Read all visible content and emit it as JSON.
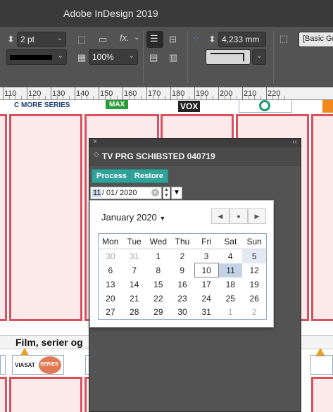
{
  "window": {
    "title": "Adobe InDesign 2019"
  },
  "control_panel": {
    "stroke_weight": "2 pt",
    "opacity": "100%",
    "fx_label": "fx.",
    "dimension": "4,233 mm",
    "style_field": "[Basic Gr"
  },
  "ruler": {
    "labels": [
      "110",
      "120",
      "130",
      "140",
      "150",
      "160",
      "170",
      "180",
      "190",
      "200",
      "210",
      "220"
    ]
  },
  "document": {
    "logos": {
      "cmore": "C MORE SERIES",
      "max": "MAX",
      "vox": "VOX",
      "viasat": "VIASAT",
      "viasat_series": "SERIES"
    },
    "film_text": "Film, serier og"
  },
  "panel": {
    "title": "TV PRG SCHIBSTED 040719",
    "arrows": "◇",
    "process_label": "Process",
    "restore_label": "Restore",
    "date_value": "11/01/2020",
    "date_parts": {
      "mm": "11",
      "dd": "01",
      "yyyy": "2020"
    }
  },
  "calendar": {
    "month_label": "January 2020",
    "weekdays": [
      "Mon",
      "Tue",
      "Wed",
      "Thu",
      "Fri",
      "Sat",
      "Sun"
    ],
    "weeks": [
      [
        "30",
        "31",
        "1",
        "2",
        "3",
        "4",
        "5"
      ],
      [
        "6",
        "7",
        "8",
        "9",
        "10",
        "11",
        "12"
      ],
      [
        "13",
        "14",
        "15",
        "16",
        "17",
        "18",
        "19"
      ],
      [
        "20",
        "21",
        "22",
        "23",
        "24",
        "25",
        "26"
      ],
      [
        "27",
        "28",
        "29",
        "30",
        "31",
        "1",
        "2"
      ]
    ],
    "today": "10",
    "selected": "11"
  }
}
